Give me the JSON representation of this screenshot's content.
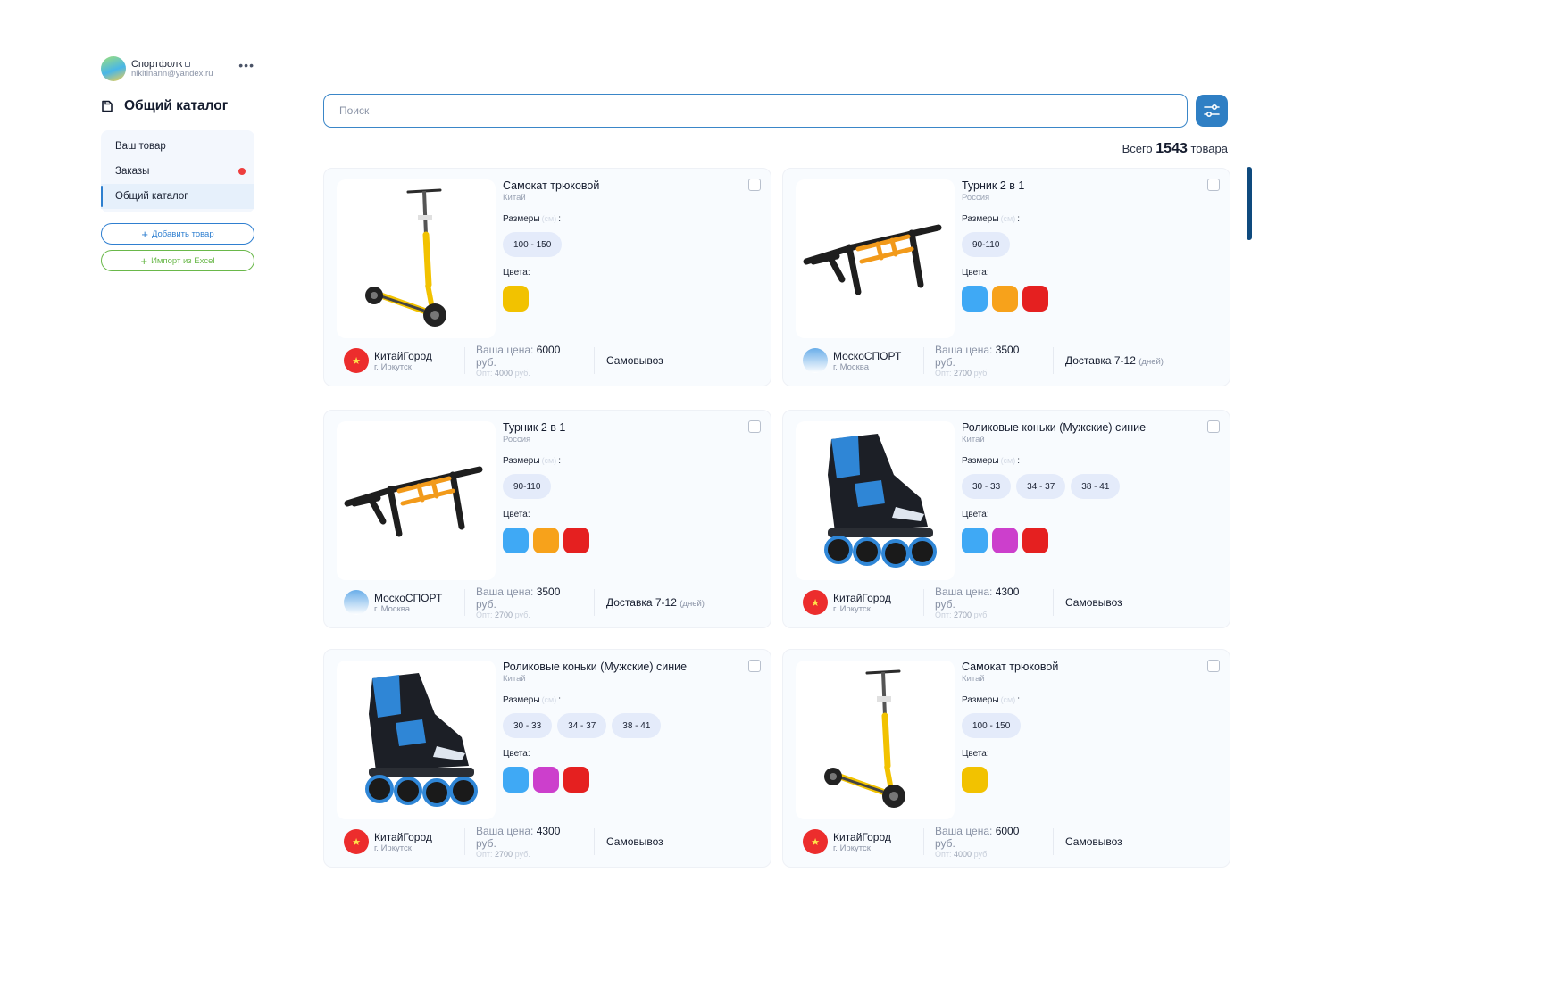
{
  "profile": {
    "name": "Спортфолк",
    "email": "nikitinann@yandex.ru"
  },
  "sidebar": {
    "title": "Общий каталог",
    "items": [
      {
        "label": "Ваш товар"
      },
      {
        "label": "Заказы"
      },
      {
        "label": "Общий каталог"
      }
    ],
    "add_button": "Добавить товар",
    "import_button": "Импорт из Excel"
  },
  "search": {
    "placeholder": "Поиск"
  },
  "total": {
    "prefix": "Всего",
    "count": "1543",
    "suffix": "товара"
  },
  "labels": {
    "sizes": "Размеры",
    "sizes_unit": "(см)",
    "colors": "Цвета:",
    "your_price": "Ваша цена:",
    "opt": "Опт:",
    "currency": "руб.",
    "days": "(дней)"
  },
  "colors": {
    "accent": "#2f7fc4",
    "yellow": "#f2c200",
    "blue": "#3fa9f5",
    "orange": "#f7a21b",
    "red": "#e52020",
    "magenta": "#cc3fcc"
  },
  "products": [
    {
      "title": "Самокат трюковой",
      "country": "Китай",
      "sizes": [
        "100 - 150"
      ],
      "colors": [
        "yellow"
      ],
      "seller": "КитайГород",
      "city": "г. Иркутск",
      "price": "6000",
      "opt": "4000",
      "delivery": "Самовывоз",
      "delivery_days": ""
    },
    {
      "title": "Турник 2 в 1",
      "country": "Россия",
      "sizes": [
        "90-110"
      ],
      "colors": [
        "blue",
        "orange",
        "red"
      ],
      "seller": "МоскоСПОРТ",
      "city": "г. Москва",
      "price": "3500",
      "opt": "2700",
      "delivery": "Доставка 7-12",
      "delivery_days": "(дней)"
    },
    {
      "title": "Турник 2 в 1",
      "country": "Россия",
      "sizes": [
        "90-110"
      ],
      "colors": [
        "blue",
        "orange",
        "red"
      ],
      "seller": "МоскоСПОРТ",
      "city": "г. Москва",
      "price": "3500",
      "opt": "2700",
      "delivery": "Доставка 7-12",
      "delivery_days": "(дней)"
    },
    {
      "title": "Роликовые коньки (Мужские) синие",
      "country": "Китай",
      "sizes": [
        "30 - 33",
        "34 - 37",
        "38 - 41"
      ],
      "colors": [
        "blue",
        "magenta",
        "red"
      ],
      "seller": "КитайГород",
      "city": "г. Иркутск",
      "price": "4300",
      "opt": "2700",
      "delivery": "Самовывоз",
      "delivery_days": ""
    },
    {
      "title": "Роликовые коньки (Мужские) синие",
      "country": "Китай",
      "sizes": [
        "30 - 33",
        "34 - 37",
        "38 - 41"
      ],
      "colors": [
        "blue",
        "magenta",
        "red"
      ],
      "seller": "КитайГород",
      "city": "г. Иркутск",
      "price": "4300",
      "opt": "2700",
      "delivery": "Самовывоз",
      "delivery_days": ""
    },
    {
      "title": "Самокат трюковой",
      "country": "Китай",
      "sizes": [
        "100 - 150"
      ],
      "colors": [
        "yellow"
      ],
      "seller": "КитайГород",
      "city": "г. Иркутск",
      "price": "6000",
      "opt": "4000",
      "delivery": "Самовывоз",
      "delivery_days": ""
    }
  ]
}
